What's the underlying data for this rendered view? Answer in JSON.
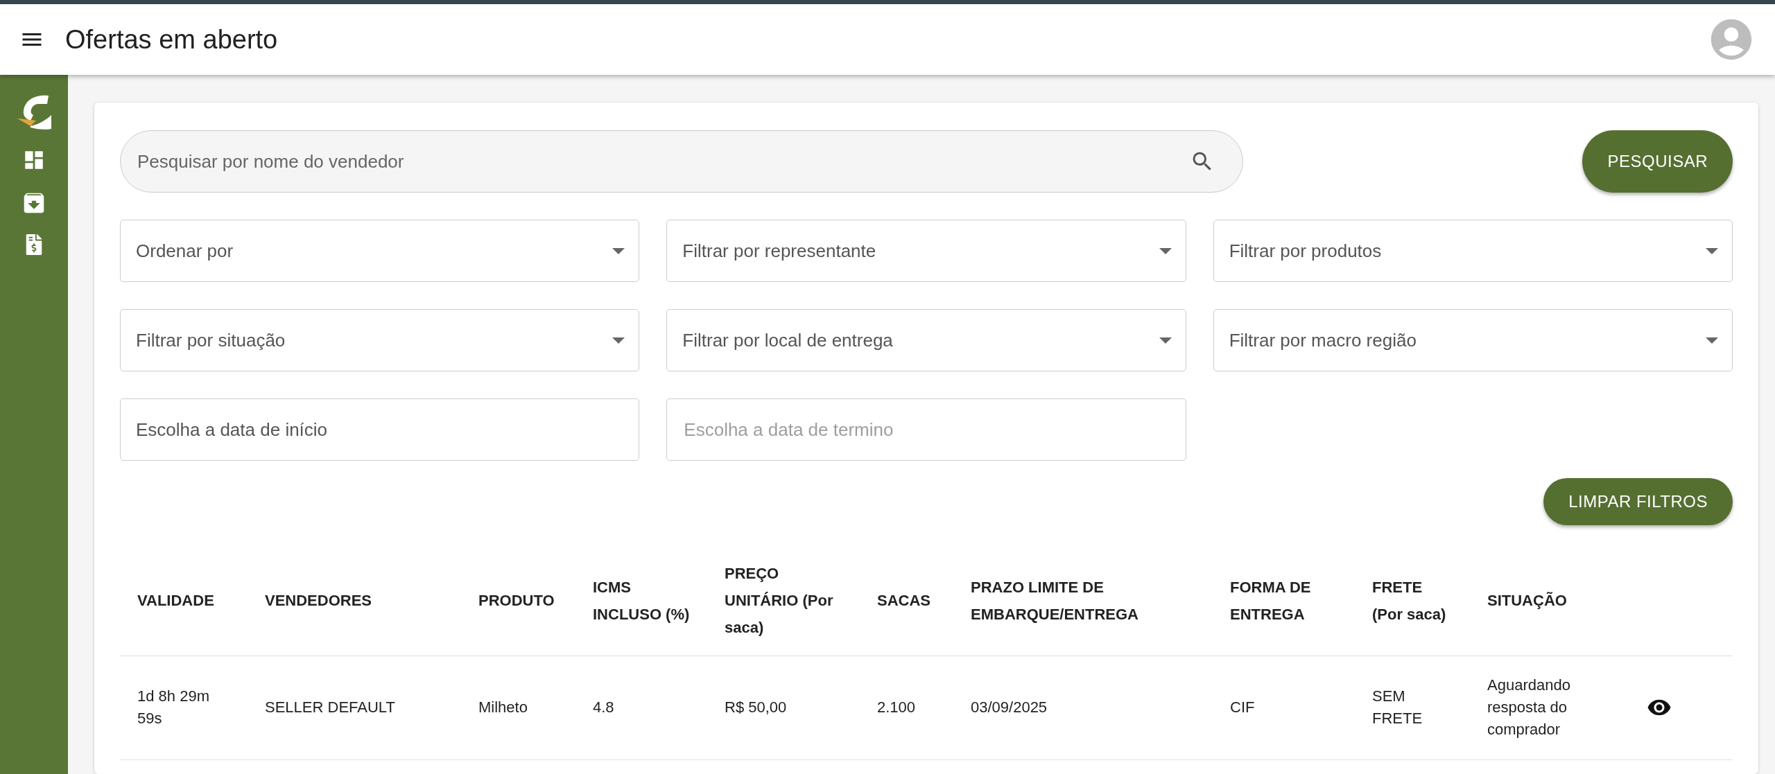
{
  "header": {
    "title": "Ofertas em aberto"
  },
  "search": {
    "placeholder": "Pesquisar por nome do vendedor",
    "button": "PESQUISAR"
  },
  "filters": [
    {
      "kind": "select",
      "label": "Ordenar por"
    },
    {
      "kind": "select",
      "label": "Filtrar por representante"
    },
    {
      "kind": "select",
      "label": "Filtrar por produtos"
    },
    {
      "kind": "select",
      "label": "Filtrar por situação"
    },
    {
      "kind": "select",
      "label": "Filtrar por local de entrega"
    },
    {
      "kind": "select",
      "label": "Filtrar por macro região"
    },
    {
      "kind": "date",
      "label": "Escolha a data de início"
    },
    {
      "kind": "date",
      "placeholder": "Escolha a data de termino"
    }
  ],
  "clear_button": "LIMPAR FILTROS",
  "table": {
    "columns": [
      "VALIDADE",
      "VENDEDORES",
      "PRODUTO",
      "ICMS INCLUSO (%)",
      "PREÇO UNITÁRIO (Por saca)",
      "SACAS",
      "PRAZO LIMITE DE EMBARQUE/ENTREGA",
      "FORMA DE ENTREGA",
      "FRETE (Por saca)",
      "SITUAÇÃO"
    ],
    "rows": [
      {
        "cells": [
          "1d 8h 29m 59s",
          "SELLER DEFAULT",
          "Milheto",
          "4.8",
          "R$ 50,00",
          "2.100",
          "03/09/2025",
          "CIF",
          "SEM FRETE",
          "Aguardando resposta do comprador"
        ]
      }
    ]
  }
}
